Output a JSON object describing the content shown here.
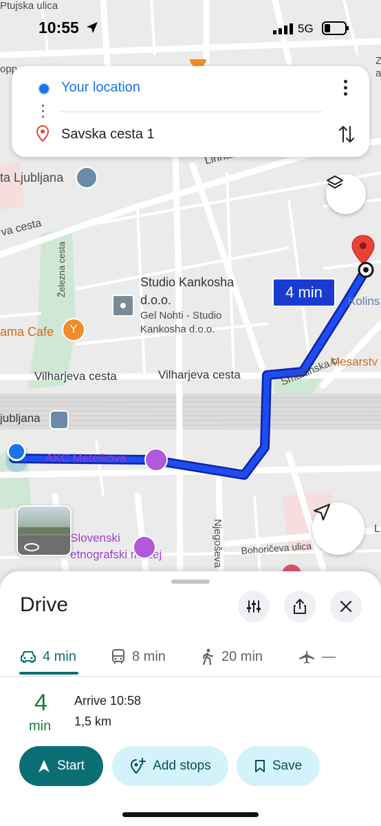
{
  "status_bar": {
    "time": "10:55",
    "network": "5G"
  },
  "directions_card": {
    "origin": "Your location",
    "destination": "Savska cesta 1"
  },
  "map": {
    "labels": {
      "ptujska": "Ptujska ulica",
      "linhartova": "Linhartova ce",
      "ljubljana_top": "ta Ljubljana",
      "va_cesta": "va cesta",
      "zelezna": "Železna cesta",
      "studio": "Studio Kankosha",
      "studio2": "d.o.o.",
      "gel1": "Gel Nohti - Studio",
      "gel2": "Kankosha d.o.o.",
      "ama_cafe": "ama Cafe",
      "kolins": "Kolins",
      "mesarst": "Mesarstv",
      "smartinska": "Šmartinska c.",
      "vilharjeva1": "Vilharjeva cesta",
      "vilharjeva2": "Vilharjeva cesta",
      "ljubljana_station": "jubljana",
      "akc": "AKC Metelkova",
      "slovenski1": "Slovenski",
      "slovenski2": "etnografski muzej",
      "njegoseva": "Njegoševa",
      "bohoriceva": "Bohoričeva ulica",
      "edge_l": "L",
      "edge_z": "Z",
      "edge_a": "a",
      "edge_oppr": "opp"
    },
    "route_time_badge": "4 min",
    "route_color": "#1a3bd1"
  },
  "sheet": {
    "title": "Drive",
    "tabs": [
      {
        "mode": "car-icon",
        "label": "4 min"
      },
      {
        "mode": "bus-icon",
        "label": "8 min"
      },
      {
        "mode": "walk-icon",
        "label": "20 min"
      },
      {
        "mode": "flight-icon",
        "label": "—"
      }
    ],
    "summary": {
      "duration_value": "4",
      "duration_unit": "min",
      "arrive": "Arrive 10:58",
      "distance": "1,5 km"
    },
    "buttons": {
      "start": "Start",
      "add_stops": "Add stops",
      "save": "Save"
    },
    "accent_color": "#0b6e75"
  }
}
